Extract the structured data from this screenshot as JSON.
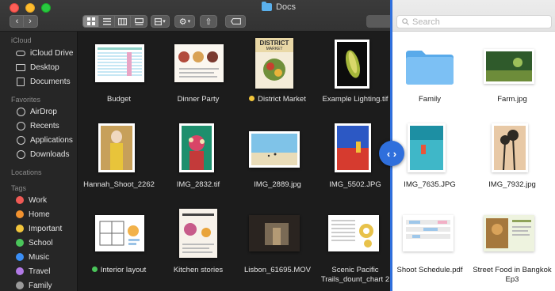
{
  "window": {
    "title": "Docs",
    "search_placeholder": "Search"
  },
  "toolbar": {
    "back_glyph": "‹",
    "forward_glyph": "›",
    "view_modes": [
      "icon-view",
      "list-view",
      "column-view",
      "gallery-view"
    ],
    "group_glyph": "▾",
    "action_glyph": "⚙",
    "share_glyph": "⇧"
  },
  "sidebar": {
    "sections": {
      "icloud": "iCloud",
      "favorites": "Favorites",
      "locations": "Locations",
      "tags": "Tags"
    },
    "icloud_items": [
      {
        "label": "iCloud Drive",
        "icon": "cloud-icon"
      },
      {
        "label": "Desktop",
        "icon": "desktop-icon"
      },
      {
        "label": "Documents",
        "icon": "documents-icon"
      }
    ],
    "favorite_items": [
      {
        "label": "AirDrop",
        "icon": "airdrop-icon"
      },
      {
        "label": "Recents",
        "icon": "clock-icon"
      },
      {
        "label": "Applications",
        "icon": "applications-icon"
      },
      {
        "label": "Downloads",
        "icon": "download-icon"
      }
    ],
    "tag_items": [
      {
        "label": "Work",
        "color": "#f05a55"
      },
      {
        "label": "Home",
        "color": "#f2922f"
      },
      {
        "label": "Important",
        "color": "#f2c53b"
      },
      {
        "label": "School",
        "color": "#4ac55a"
      },
      {
        "label": "Music",
        "color": "#3a8ef5"
      },
      {
        "label": "Travel",
        "color": "#b27ae6"
      },
      {
        "label": "Family",
        "color": "#9a9a9a"
      }
    ]
  },
  "files_dark": [
    {
      "name": "Budget"
    },
    {
      "name": "Dinner Party"
    },
    {
      "name": "District Market",
      "tag_color": "#f2c53b"
    },
    {
      "name": "Example Lighting.tif"
    },
    {
      "name": "Hannah_Shoot_2262"
    },
    {
      "name": "IMG_2832.tif"
    },
    {
      "name": "IMG_2889.jpg"
    },
    {
      "name": "IMG_5502.JPG"
    },
    {
      "name": "Interior layout",
      "tag_color": "#4ac55a"
    },
    {
      "name": "Kitchen stories"
    },
    {
      "name": "Lisbon_61695.MOV"
    },
    {
      "name": "Scenic Pacific Trails_dount_chart 2"
    }
  ],
  "files_light": [
    {
      "name": "Family"
    },
    {
      "name": "Farm.jpg"
    },
    {
      "name": "IMG_7635.JPG"
    },
    {
      "name": "IMG_7932.jpg"
    },
    {
      "name": "Shoot Schedule.pdf"
    },
    {
      "name": "Street Food in Bangkok Ep3"
    }
  ],
  "thumb_text": {
    "district_market": "DISTRICT",
    "district_market_sub": "MARKET"
  },
  "divider": {
    "handle_glyph": "‹ ›"
  },
  "colors": {
    "accent": "#2f6fdc",
    "folder": "#5ab0ec"
  }
}
